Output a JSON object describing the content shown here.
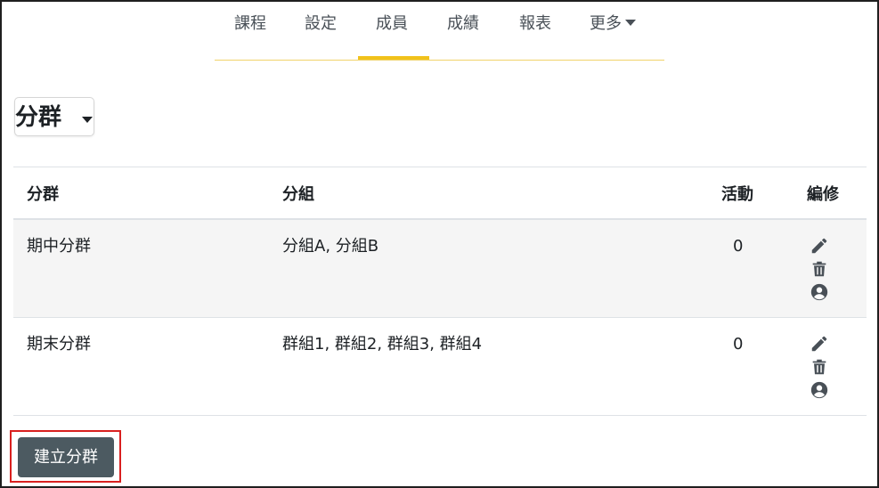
{
  "nav": {
    "items": [
      {
        "label": "課程"
      },
      {
        "label": "設定"
      },
      {
        "label": "成員"
      },
      {
        "label": "成績"
      },
      {
        "label": "報表"
      },
      {
        "label": "更多"
      }
    ],
    "active": "成員"
  },
  "heading": {
    "label": "分群"
  },
  "table": {
    "headers": {
      "grouping": "分群",
      "groups": "分組",
      "activities": "活動",
      "edit": "編修"
    },
    "rows": [
      {
        "grouping": "期中分群",
        "groups": "分組A, 分組B",
        "activities": "0"
      },
      {
        "grouping": "期末分群",
        "groups": "群組1, 群組2, 群組3, 群組4",
        "activities": "0"
      }
    ]
  },
  "create_button": {
    "label": "建立分群"
  },
  "icons": {
    "edit": "pencil-icon",
    "delete": "trash-icon",
    "members": "user-circle-icon"
  },
  "colors": {
    "accent": "#f1c21b",
    "button_bg": "#4c5a61",
    "highlight": "#d9201f"
  }
}
